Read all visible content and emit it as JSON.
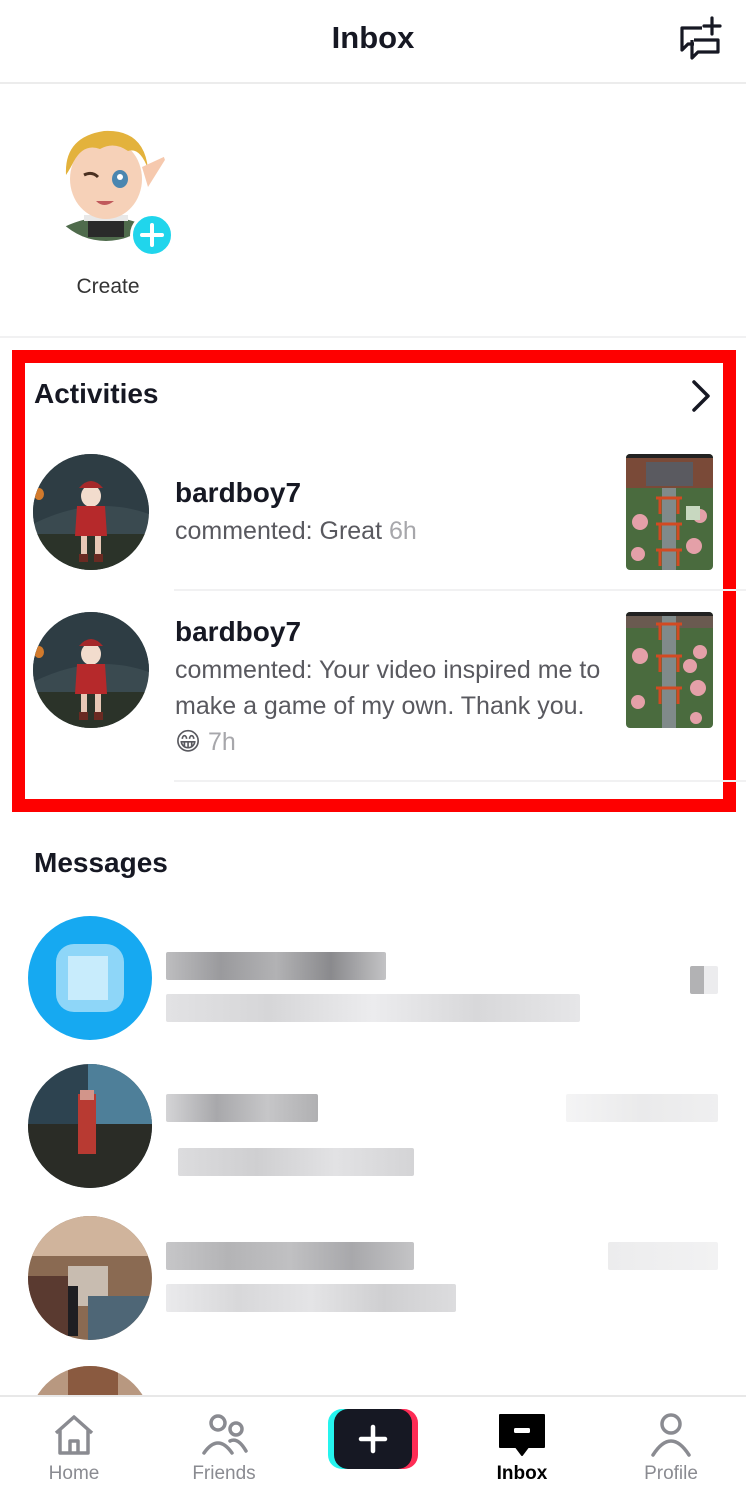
{
  "header": {
    "title": "Inbox",
    "compose_icon": "new-message-icon"
  },
  "create": {
    "label": "Create",
    "plus_icon": "plus-icon"
  },
  "activities": {
    "title": "Activities",
    "chevron_icon": "chevron-right-icon",
    "items": [
      {
        "username": "bardboy7",
        "comment": "commented: Great",
        "time": "6h"
      },
      {
        "username": "bardboy7",
        "comment": "commented: Your video inspired me to make a game of my own. Thank you.",
        "emoji": "😁",
        "time": "7h"
      }
    ]
  },
  "messages": {
    "title": "Messages",
    "items": [
      {
        "name": "[blurred]",
        "preview": "[blurred]",
        "time": "[blurred]",
        "avatar_color": "#16a9f1"
      },
      {
        "name": "[blurred]",
        "preview": "[blurred]",
        "time": "[blurred]",
        "avatar_color": "#2d4350"
      },
      {
        "name": "[blurred]",
        "preview": "[blurred]",
        "time": "[blurred]",
        "avatar_color": "#8a6a52"
      }
    ]
  },
  "nav": {
    "tabs": [
      {
        "label": "Home",
        "icon": "home-icon",
        "active": false
      },
      {
        "label": "Friends",
        "icon": "friends-icon",
        "active": false
      },
      {
        "label": "",
        "icon": "create-plus-icon",
        "active": false
      },
      {
        "label": "Inbox",
        "icon": "inbox-icon",
        "active": true
      },
      {
        "label": "Profile",
        "icon": "profile-icon",
        "active": false
      }
    ]
  },
  "colors": {
    "highlight_border": "#fe0000",
    "create_plus": "#20d5ec",
    "tiktok_cyan": "#25f4ee",
    "tiktok_red": "#fe2c55",
    "text_primary": "#161823",
    "text_muted": "#a7a7ab"
  }
}
